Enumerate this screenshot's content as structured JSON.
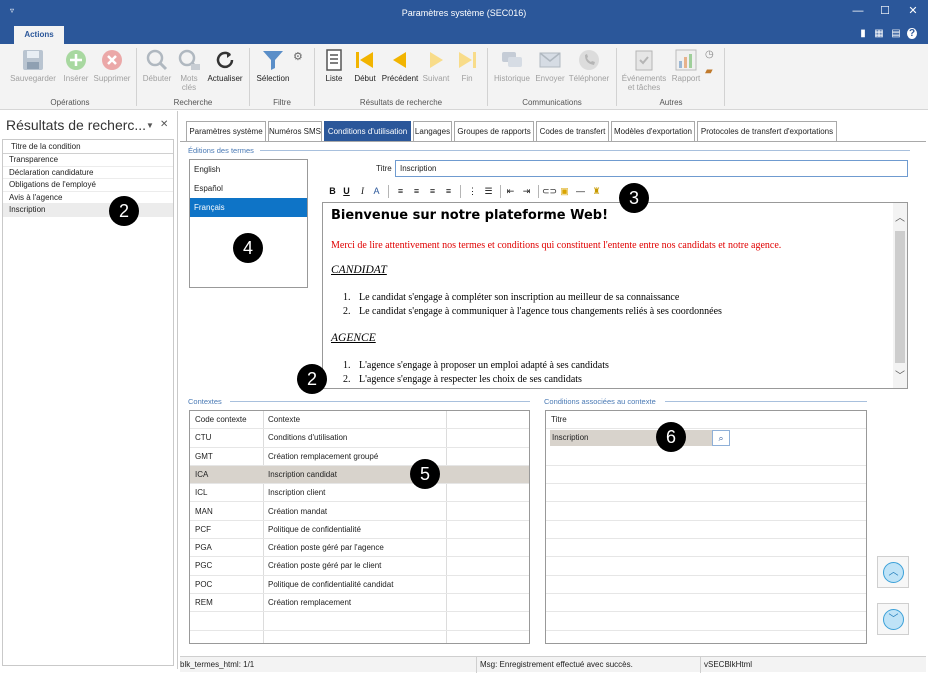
{
  "window": {
    "title": "Paramètres système (SEC016)"
  },
  "ribbon": {
    "tab": "Actions",
    "buttons": {
      "sauvegarder": "Sauvegarder",
      "inserer": "Insérer",
      "supprimer": "Supprimer",
      "debuter": "Débuter",
      "mots_cles_1": "Mots",
      "mots_cles_2": "clés",
      "actualiser": "Actualiser",
      "selection": "Sélection",
      "liste": "Liste",
      "debut": "Début",
      "precedent": "Précédent",
      "suivant": "Suivant",
      "fin": "Fin",
      "historique": "Historique",
      "envoyer": "Envoyer",
      "telephoner": "Téléphoner",
      "evenements_1": "Événements",
      "evenements_2": "et tâches",
      "rapport": "Rapport"
    },
    "groups": {
      "operations": "Opérations",
      "recherche": "Recherche",
      "filtre": "Filtre",
      "resultats": "Résultats de recherche",
      "communications": "Communications",
      "autres": "Autres"
    }
  },
  "left_panel": {
    "title": "Résultats de recherc...",
    "column_header": "Titre de la condition",
    "rows": [
      "Transparence",
      "Déclaration candidature",
      "Obligations de l'employé",
      "Avis à l'agence",
      "Inscription"
    ]
  },
  "tabs": [
    "Paramètres système",
    "Numéros SMS",
    "Conditions d'utilisation",
    "Langages",
    "Groupes de rapports",
    "Codes de transfert",
    "Modèles d'exportation",
    "Protocoles de transfert d'exportations"
  ],
  "editions": {
    "section_label": "Éditions des termes",
    "languages": [
      "English",
      "Español",
      "Français"
    ],
    "title_label": "Titre",
    "title_value": "Inscription"
  },
  "editor": {
    "heading": "Bienvenue sur notre plateforme Web!",
    "intro": "Merci de lire attentivement nos termes et conditions qui constituent l'entente entre nos candidats et notre agence.",
    "section1": "CANDIDAT",
    "section1_items": [
      "Le candidat s'engage à compléter son inscription au meilleur de sa connaissance",
      "Le candidat s'engage à communiquer à l'agence tous changements reliés à ses coordonnées"
    ],
    "section2": "AGENCE",
    "section2_items": [
      "L'agence s'engage à proposer un emploi adapté à ses candidats",
      "L'agence s'engage à respecter les choix de ses candidats"
    ],
    "item_numbers": [
      "1.",
      "2."
    ]
  },
  "contexts": {
    "section_label": "Contextes",
    "headers": [
      "Code contexte",
      "Contexte"
    ],
    "rows": [
      [
        "CTU",
        "Conditions d'utilisation"
      ],
      [
        "GMT",
        "Création remplacement groupé"
      ],
      [
        "ICA",
        "Inscription candidat"
      ],
      [
        "ICL",
        "Inscription client"
      ],
      [
        "MAN",
        "Création mandat"
      ],
      [
        "PCF",
        "Politique de confidentialité"
      ],
      [
        "PGA",
        "Création poste géré par l'agence"
      ],
      [
        "PGC",
        "Création poste géré par le client"
      ],
      [
        "POC",
        "Politique de confidentialité candidat"
      ],
      [
        "REM",
        "Création remplacement"
      ]
    ]
  },
  "conditions": {
    "section_label": "Conditions associées au contexte",
    "header": "Titre",
    "selected_value": "Inscription"
  },
  "status_bar": {
    "left": "blk_termes_html: 1/1",
    "middle": "Msg: Enregistrement effectué avec succès.",
    "right": "vSECBlkHtml"
  },
  "callouts": [
    "2",
    "3",
    "4",
    "2",
    "5",
    "6"
  ]
}
